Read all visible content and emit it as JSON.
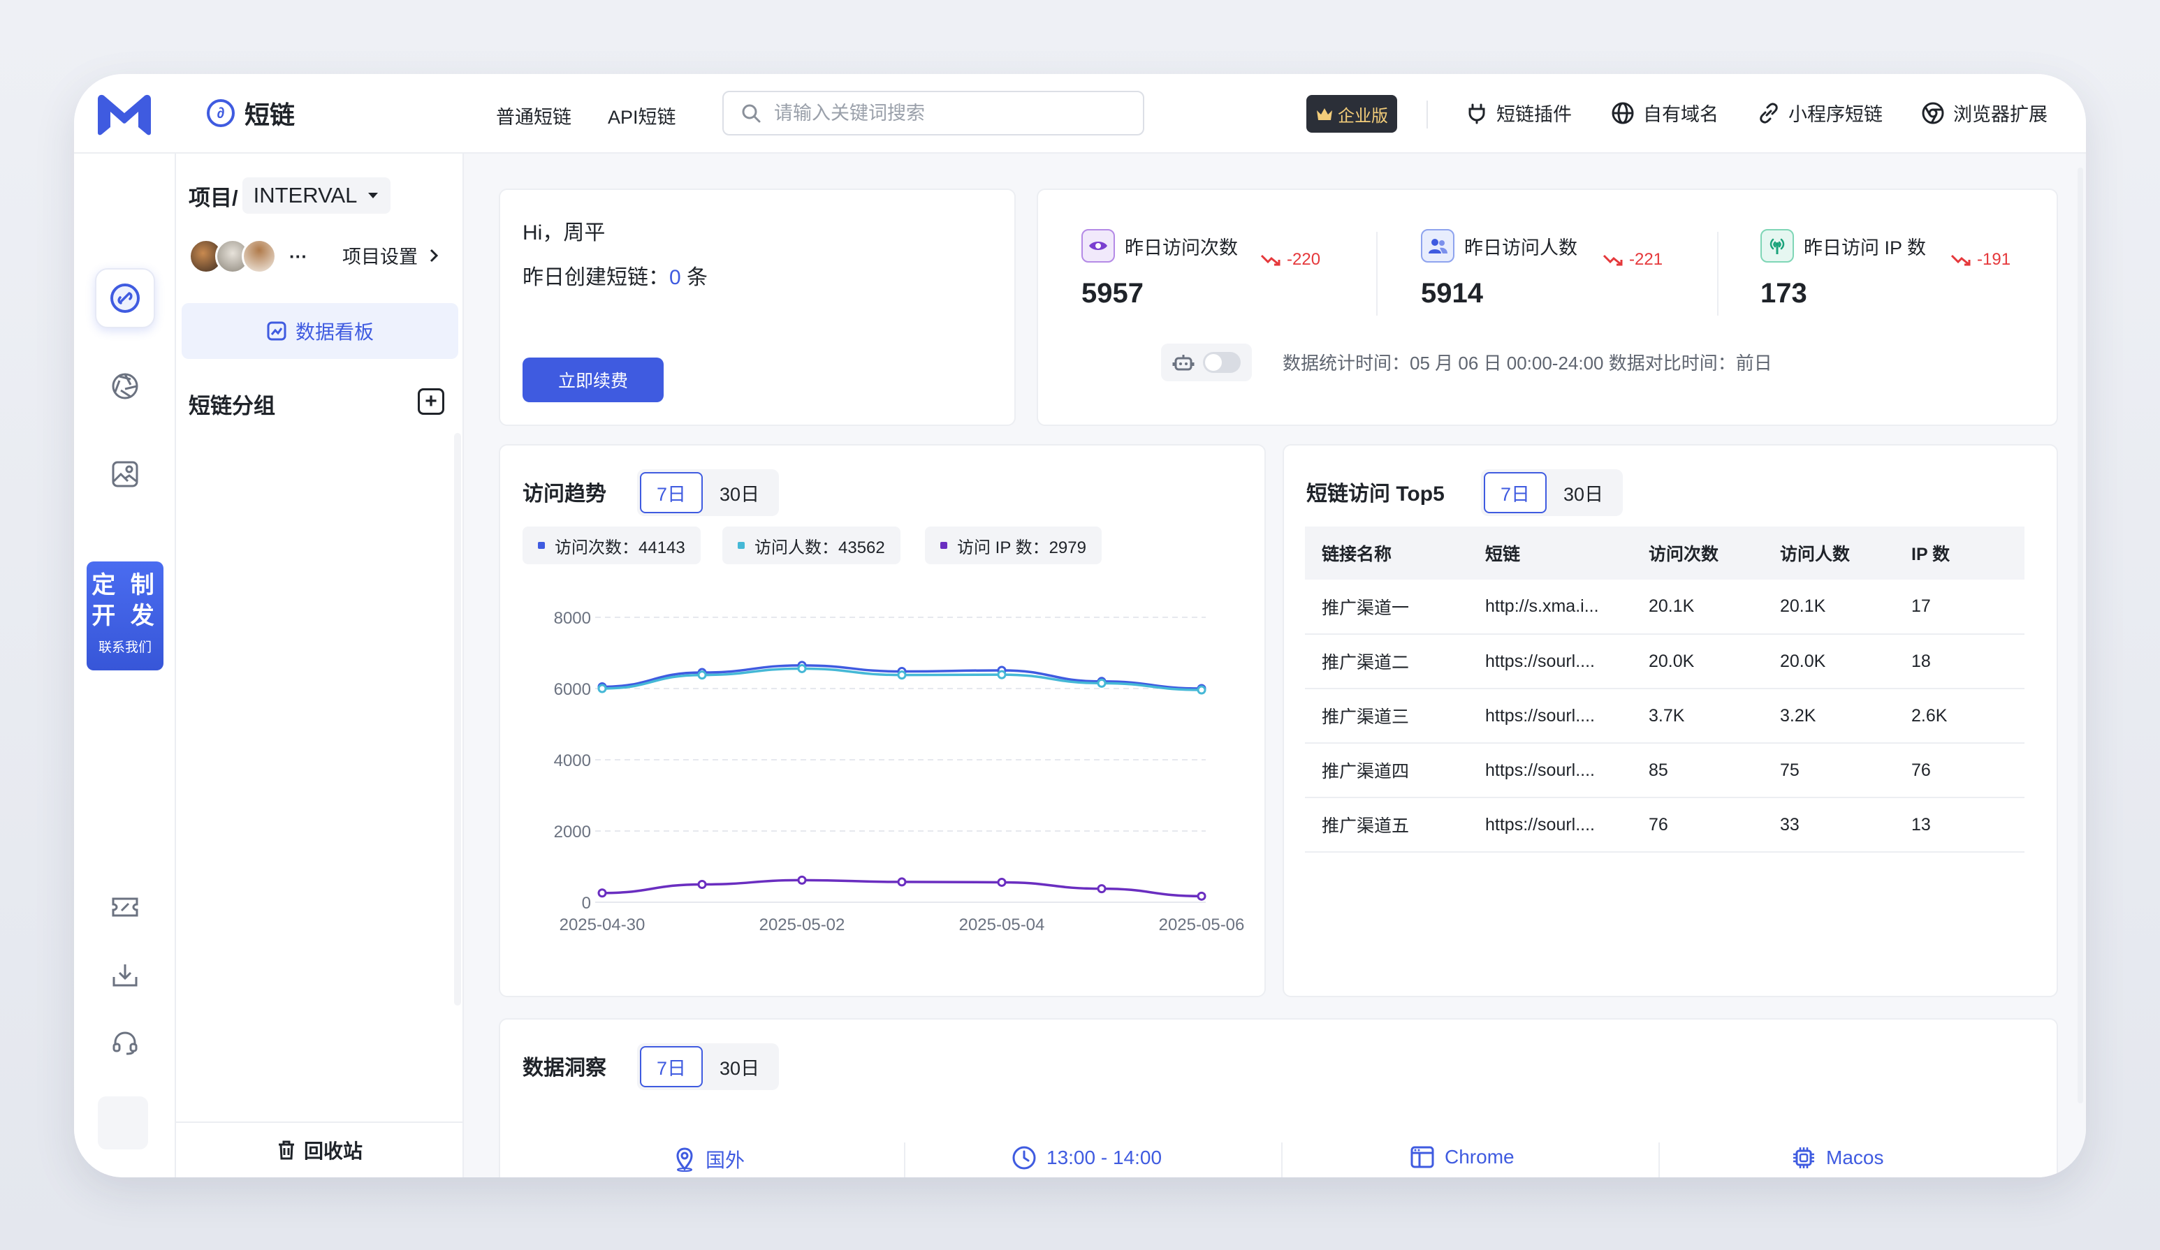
{
  "topbar": {
    "brand": "短链",
    "nav": [
      "普通短链",
      "API短链"
    ],
    "search_placeholder": "请输入关键词搜索",
    "enterprise_badge": "企业版",
    "tools": [
      "短链插件",
      "自有域名",
      "小程序短链",
      "浏览器扩展"
    ]
  },
  "rail": {
    "custom_big_1": "定 制",
    "custom_big_2": "开 发",
    "custom_small": "联系我们"
  },
  "project": {
    "prefix": "项目/",
    "name": "INTERVAL",
    "settings": "项目设置",
    "more": "···",
    "dashboard": "数据看板",
    "group_title": "短链分组",
    "recycle": "回收站"
  },
  "welcome": {
    "greeting": "Hi，周平",
    "created_label": "昨日创建短链：",
    "created_count": "0",
    "created_unit": "条",
    "renew": "立即续费"
  },
  "stats": {
    "items": [
      {
        "label": "昨日访问次数",
        "value": "5957",
        "delta": "-220"
      },
      {
        "label": "昨日访问人数",
        "value": "5914",
        "delta": "-221"
      },
      {
        "label": "昨日访问 IP 数",
        "value": "173",
        "delta": "-191"
      }
    ],
    "footer": "数据统计时间：05 月 06 日 00:00-24:00 数据对比时间：前日"
  },
  "trend": {
    "title": "访问趋势",
    "tabs": [
      "7日",
      "30日"
    ],
    "legend": [
      "访问次数：44143",
      "访问人数：43562",
      "访问 IP 数：2979"
    ]
  },
  "top5": {
    "title": "短链访问 Top5",
    "tabs": [
      "7日",
      "30日"
    ],
    "headers": [
      "链接名称",
      "短链",
      "访问次数",
      "访问人数",
      "IP 数"
    ],
    "rows": [
      [
        "推广渠道一",
        "http://s.xma.i...",
        "20.1K",
        "20.1K",
        "17"
      ],
      [
        "推广渠道二",
        "https://sourl....",
        "20.0K",
        "20.0K",
        "18"
      ],
      [
        "推广渠道三",
        "https://sourl....",
        "3.7K",
        "3.2K",
        "2.6K"
      ],
      [
        "推广渠道四",
        "https://sourl....",
        "85",
        "75",
        "76"
      ],
      [
        "推广渠道五",
        "https://sourl....",
        "76",
        "33",
        "13"
      ]
    ]
  },
  "insight": {
    "title": "数据洞察",
    "tabs": [
      "7日",
      "30日"
    ],
    "items": [
      "国外",
      "13:00 - 14:00",
      "Chrome",
      "Macos"
    ]
  },
  "colors": {
    "accent": "#3f5be0",
    "series_visits": "#3f5be0",
    "series_users": "#45b8d6",
    "series_ip": "#6a2ec0",
    "negative": "#e5383b"
  },
  "chart_data": {
    "type": "line",
    "x": [
      "2025-04-30",
      "2025-05-01",
      "2025-05-02",
      "2025-05-03",
      "2025-05-04",
      "2025-05-05",
      "2025-05-06"
    ],
    "xticks": [
      "2025-04-30",
      "2025-05-02",
      "2025-05-04",
      "2025-05-06"
    ],
    "ylim": [
      0,
      8000
    ],
    "yticks": [
      0,
      2000,
      4000,
      6000,
      8000
    ],
    "grid": true,
    "series": [
      {
        "name": "访问次数",
        "values": [
          6050,
          6450,
          6650,
          6480,
          6510,
          6200,
          6000
        ]
      },
      {
        "name": "访问人数",
        "values": [
          6000,
          6380,
          6560,
          6380,
          6390,
          6150,
          5960
        ]
      },
      {
        "name": "访问 IP 数",
        "values": [
          260,
          500,
          620,
          570,
          560,
          380,
          170
        ]
      }
    ]
  }
}
